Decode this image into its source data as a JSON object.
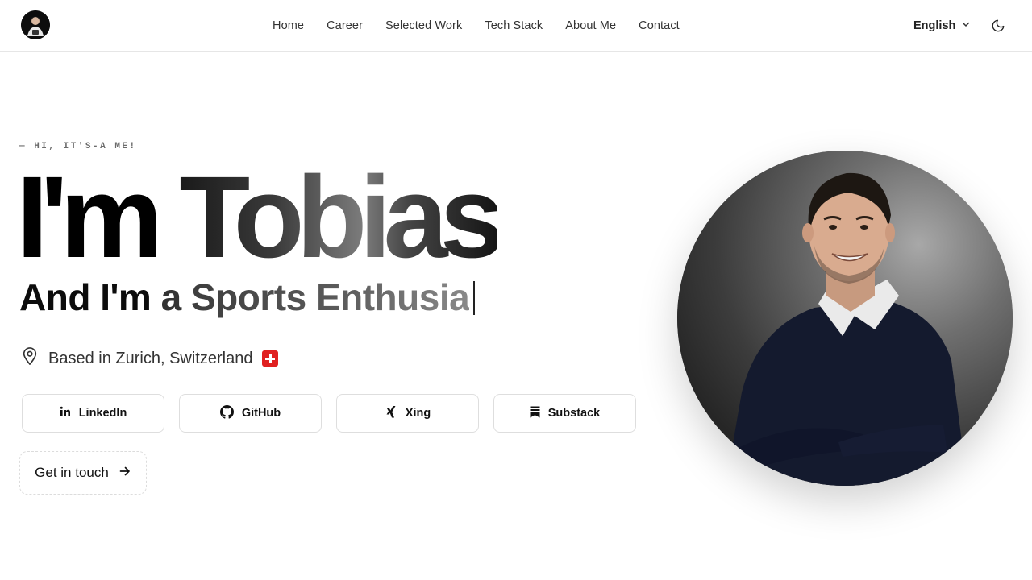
{
  "nav": {
    "items": [
      "Home",
      "Career",
      "Selected Work",
      "Tech Stack",
      "About Me",
      "Contact"
    ]
  },
  "header": {
    "language": "English",
    "logo_icon": "avatar-logo",
    "theme_icon": "moon-icon"
  },
  "hero": {
    "eyebrow": "— HI, IT'S-A ME!",
    "title_part1": "I'm",
    "title_part2": "Tobias",
    "subtitle_static": "And I'm",
    "subtitle_article": "a",
    "subtitle_typed": "Sports Enthusia",
    "location": "Based in Zurich, Switzerland",
    "location_icon": "map-pin-icon",
    "flag": "swiss-flag"
  },
  "socials": [
    {
      "label": "LinkedIn",
      "icon": "linkedin-icon"
    },
    {
      "label": "GitHub",
      "icon": "github-icon"
    },
    {
      "label": "Xing",
      "icon": "xing-icon"
    },
    {
      "label": "Substack",
      "icon": "substack-icon"
    }
  ],
  "cta": {
    "label": "Get in touch",
    "icon": "arrow-right-icon"
  },
  "colors": {
    "background": "#ffffff",
    "text": "#111111",
    "accent_red": "#e02020"
  }
}
